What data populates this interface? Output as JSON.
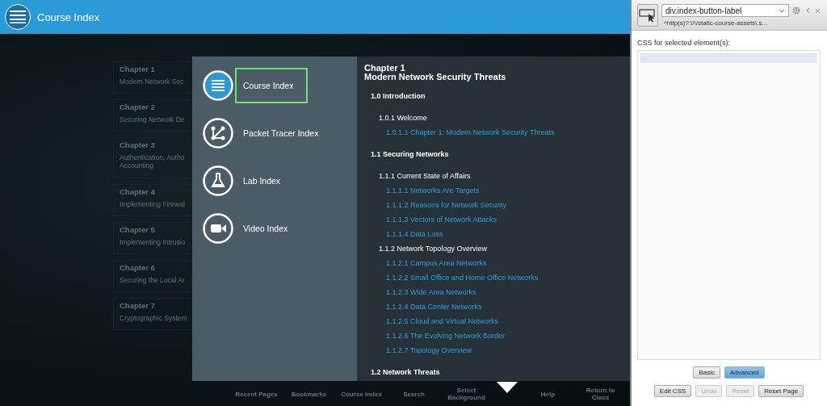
{
  "header": {
    "title": "Course Index"
  },
  "chapters": [
    {
      "number": "Chapter 1",
      "title": "Modern Network Sec"
    },
    {
      "number": "Chapter 2",
      "title": "Securing Network De"
    },
    {
      "number": "Chapter 3",
      "title": "Authentication, Autho Accounting"
    },
    {
      "number": "Chapter 4",
      "title": "Implementing Firewal"
    },
    {
      "number": "Chapter 5",
      "title": "Implementing Intrusio"
    },
    {
      "number": "Chapter 6",
      "title": "Securing the Local Ar"
    },
    {
      "number": "Chapter 7",
      "title": "Cryptographic System"
    }
  ],
  "index_menu": [
    {
      "kind": "course",
      "label": "Course Index",
      "selected": true
    },
    {
      "kind": "packet",
      "label": "Packet Tracer Index",
      "selected": false
    },
    {
      "kind": "lab",
      "label": "Lab Index",
      "selected": false
    },
    {
      "kind": "video",
      "label": "Video Index",
      "selected": false
    }
  ],
  "contents": {
    "chapter": "Chapter 1",
    "title": "Modern Network Security Threats",
    "sections": [
      {
        "label": "1.0 Introduction",
        "children": [
          {
            "label": "1.0.1 Welcome",
            "children": [
              {
                "label": "1.0.1.1 Chapter 1: Modern Network Security Threats"
              }
            ]
          }
        ]
      },
      {
        "label": "1.1 Securing Networks",
        "children": [
          {
            "label": "1.1.1 Current State of Affairs",
            "children": [
              {
                "label": "1.1.1.1 Networks Are Targets"
              },
              {
                "label": "1.1.1.2 Reasons for Network Security"
              },
              {
                "label": "1.1.1.3 Vectors of Network Attacks"
              },
              {
                "label": "1.1.1.4 Data Loss"
              }
            ]
          },
          {
            "label": "1.1.2 Network Topology Overview",
            "children": [
              {
                "label": "1.1.2.1 Campus Area Networks"
              },
              {
                "label": "1.1.2.2 Small Office and Home Office Networks"
              },
              {
                "label": "1.1.2.3 Wide Area Networks"
              },
              {
                "label": "1.1.2.4 Data Center Networks"
              },
              {
                "label": "1.1.2.5 Cloud and Virtual Networks"
              },
              {
                "label": "1.1.2.6 The Evolving Network Border"
              },
              {
                "label": "1.1.2.7 Topology Overview"
              }
            ]
          }
        ]
      },
      {
        "label": "1.2 Network Threats"
      }
    ]
  },
  "toolbar": [
    "Recent Pages",
    "Bookmarks",
    "Course Index",
    "Search",
    "Select Background",
    "Help",
    "Return to Class"
  ],
  "css_panel": {
    "selector": "div.index-button-label",
    "url_pattern": "^http(s)?:\\/\\/static-course-assets\\.s...",
    "css_label": "CSS for selected element(s):",
    "mode_buttons": [
      {
        "label": "Basic",
        "selected": false
      },
      {
        "label": "Advanced",
        "selected": true
      }
    ],
    "action_buttons": [
      {
        "label": "Edit CSS",
        "disabled": false
      },
      {
        "label": "Undo",
        "disabled": true
      },
      {
        "label": "Reset",
        "disabled": true
      },
      {
        "label": "Reset Page",
        "disabled": false
      }
    ]
  }
}
